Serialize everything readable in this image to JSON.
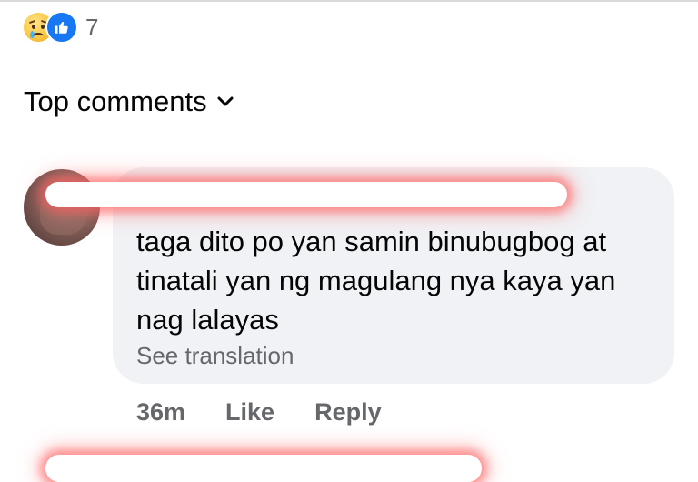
{
  "reactions": {
    "icons": [
      "sad-reaction-icon",
      "like-reaction-icon"
    ],
    "count": "7"
  },
  "comments_header": {
    "label": "Top comments",
    "chevron_icon": "chevron-down-icon"
  },
  "comment": {
    "author_name": "",
    "text": "taga dito po yan samin binubugbog at tinatali yan ng magulang nya kaya yan nag lalayas",
    "translation_link": "See translation",
    "time": "36m",
    "like_label": "Like",
    "reply_label": "Reply"
  },
  "colors": {
    "bubble": "#f0f2f5",
    "secondary_text": "#65676b",
    "like_blue": "#1877f2",
    "redaction_glow": "#ff5a5a"
  }
}
